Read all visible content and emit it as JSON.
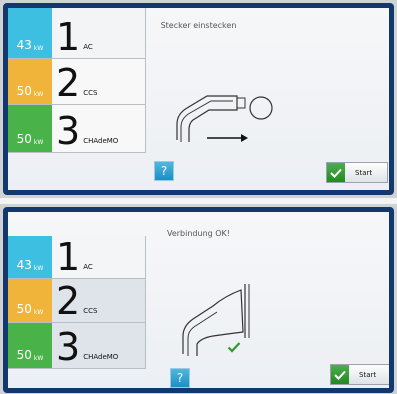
{
  "panels": [
    {
      "status": "Stecker einstecken",
      "connectors": [
        {
          "power": "43",
          "unit": "kW",
          "number": "1",
          "type": "AC",
          "color": "#3cbfe0"
        },
        {
          "power": "50",
          "unit": "kW",
          "number": "2",
          "type": "CCS",
          "color": "#f0b43a"
        },
        {
          "power": "50",
          "unit": "kW",
          "number": "3",
          "type": "CHAdeMO",
          "color": "#49b34a"
        }
      ],
      "help_label": "?",
      "start_label": "Start"
    },
    {
      "status": "Verbindung OK!",
      "connectors": [
        {
          "power": "43",
          "unit": "kW",
          "number": "1",
          "type": "AC",
          "color": "#3cbfe0"
        },
        {
          "power": "50",
          "unit": "kW",
          "number": "2",
          "type": "CCS",
          "color": "#f0b43a"
        },
        {
          "power": "50",
          "unit": "kW",
          "number": "3",
          "type": "CHAdeMO",
          "color": "#49b34a"
        }
      ],
      "help_label": "?",
      "start_label": "Start"
    }
  ],
  "colors": {
    "frame": "#12386e",
    "help_button": "#1d8dc4",
    "start_check": "#238a23"
  },
  "icons": [
    "plug-icon",
    "socket-icon",
    "arrow-right-icon",
    "plug-connected-icon",
    "check-icon"
  ]
}
